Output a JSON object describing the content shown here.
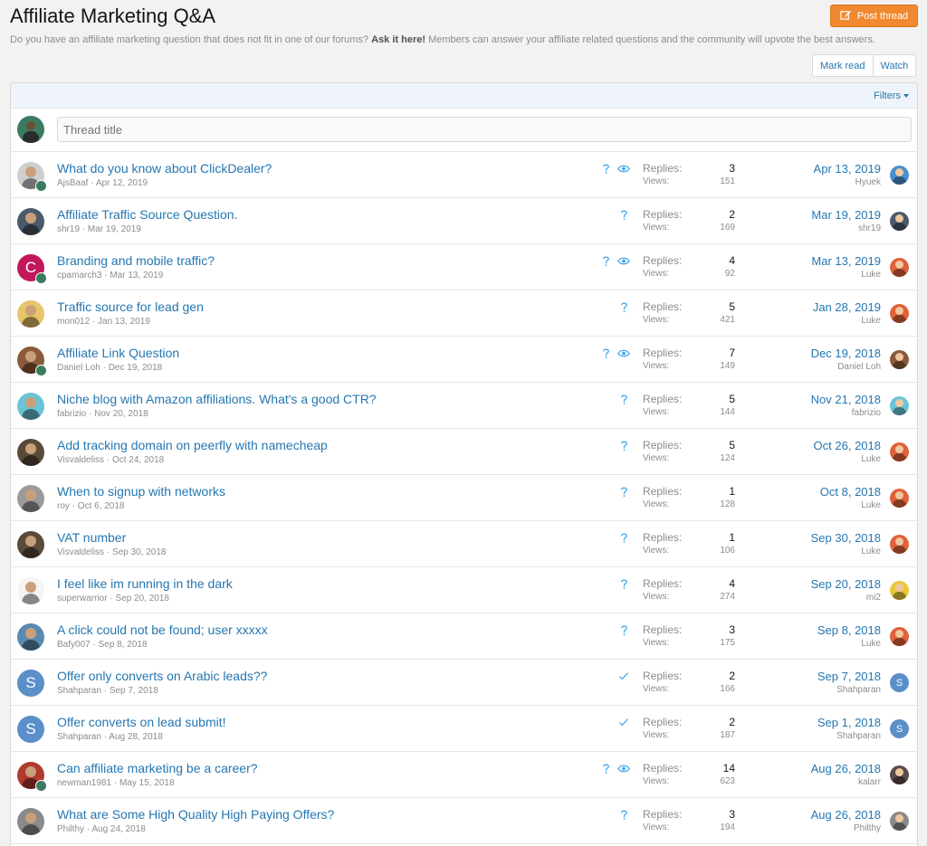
{
  "header": {
    "title": "Affiliate Marketing Q&A",
    "post_button": "Post thread",
    "description_pre": "Do you have an affiliate marketing question that does not fit in one of our forums? ",
    "description_bold": "Ask it here!",
    "description_post": " Members can answer your affiliate related questions and the community will upvote the best answers."
  },
  "actions": {
    "mark_read": "Mark read",
    "watch": "Watch"
  },
  "filters_label": "Filters",
  "quick_thread": {
    "placeholder": "Thread title"
  },
  "labels": {
    "replies": "Replies:",
    "views": "Views:"
  },
  "colors": {
    "link": "#2577b1",
    "accent": "#f0892f",
    "muted": "#8c8c8c"
  },
  "threads": [
    {
      "title": "What do you know about ClickDealer?",
      "author": "AjsBaaf",
      "date": "Apr 12, 2019",
      "replies": "3",
      "views": "151",
      "last_date": "Apr 13, 2019",
      "last_user": "Hyuek",
      "status": "question",
      "watched": true,
      "avatar_color": "#cfcfcf",
      "avatar_letter": "",
      "mini": true,
      "last_avatar_color": "#4a8fd0",
      "last_avatar_letter": ""
    },
    {
      "title": "Affiliate Traffic Source Question.",
      "author": "shr19",
      "date": "Mar 19, 2019",
      "replies": "2",
      "views": "169",
      "last_date": "Mar 19, 2019",
      "last_user": "shr19",
      "status": "question",
      "watched": false,
      "avatar_color": "#4a5a6a",
      "avatar_letter": "",
      "mini": false,
      "last_avatar_color": "#4a5a6a",
      "last_avatar_letter": ""
    },
    {
      "title": "Branding and mobile traffic?",
      "author": "cpamarch3",
      "date": "Mar 13, 2019",
      "replies": "4",
      "views": "92",
      "last_date": "Mar 13, 2019",
      "last_user": "Luke",
      "status": "question",
      "watched": true,
      "avatar_color": "#c2185b",
      "avatar_letter": "C",
      "mini": true,
      "last_avatar_color": "#e0613a",
      "last_avatar_letter": ""
    },
    {
      "title": "Traffic source for lead gen",
      "author": "mon012",
      "date": "Jan 13, 2019",
      "replies": "5",
      "views": "421",
      "last_date": "Jan 28, 2019",
      "last_user": "Luke",
      "status": "question",
      "watched": false,
      "avatar_color": "#e8c46a",
      "avatar_letter": "",
      "mini": false,
      "last_avatar_color": "#e0613a",
      "last_avatar_letter": ""
    },
    {
      "title": "Affiliate Link Question",
      "author": "Daniel Loh",
      "date": "Dec 19, 2018",
      "replies": "7",
      "views": "149",
      "last_date": "Dec 19, 2018",
      "last_user": "Daniel Loh",
      "status": "question",
      "watched": true,
      "avatar_color": "#8a5a3a",
      "avatar_letter": "",
      "mini": true,
      "last_avatar_color": "#8a5a3a",
      "last_avatar_letter": ""
    },
    {
      "title": "Niche blog with Amazon affiliations. What's a good CTR?",
      "author": "fabrizio",
      "date": "Nov 20, 2018",
      "replies": "5",
      "views": "144",
      "last_date": "Nov 21, 2018",
      "last_user": "fabrizio",
      "status": "question",
      "watched": false,
      "avatar_color": "#6ac4d6",
      "avatar_letter": "",
      "mini": false,
      "last_avatar_color": "#6ac4d6",
      "last_avatar_letter": ""
    },
    {
      "title": "Add tracking domain on peerfly with namecheap",
      "author": "Visvaldeliss",
      "date": "Oct 24, 2018",
      "replies": "5",
      "views": "124",
      "last_date": "Oct 26, 2018",
      "last_user": "Luke",
      "status": "question",
      "watched": false,
      "avatar_color": "#5a4a3a",
      "avatar_letter": "",
      "mini": false,
      "last_avatar_color": "#e0613a",
      "last_avatar_letter": ""
    },
    {
      "title": "When to signup with networks",
      "author": "roy",
      "date": "Oct 6, 2018",
      "replies": "1",
      "views": "128",
      "last_date": "Oct 8, 2018",
      "last_user": "Luke",
      "status": "question",
      "watched": false,
      "avatar_color": "#9a9a9a",
      "avatar_letter": "",
      "mini": false,
      "last_avatar_color": "#e0613a",
      "last_avatar_letter": ""
    },
    {
      "title": "VAT number",
      "author": "Visvaldeliss",
      "date": "Sep 30, 2018",
      "replies": "1",
      "views": "106",
      "last_date": "Sep 30, 2018",
      "last_user": "Luke",
      "status": "question",
      "watched": false,
      "avatar_color": "#5a4a3a",
      "avatar_letter": "",
      "mini": false,
      "last_avatar_color": "#e0613a",
      "last_avatar_letter": ""
    },
    {
      "title": "I feel like im running in the dark",
      "author": "superwarrior",
      "date": "Sep 20, 2018",
      "replies": "4",
      "views": "274",
      "last_date": "Sep 20, 2018",
      "last_user": "mi2",
      "status": "question",
      "watched": false,
      "avatar_color": "#f4f4f4",
      "avatar_letter": "",
      "mini": false,
      "last_avatar_color": "#e8c83a",
      "last_avatar_letter": ""
    },
    {
      "title": "A click could not be found; user xxxxx",
      "author": "Bafy007",
      "date": "Sep 8, 2018",
      "replies": "3",
      "views": "175",
      "last_date": "Sep 8, 2018",
      "last_user": "Luke",
      "status": "question",
      "watched": false,
      "avatar_color": "#5a8ab0",
      "avatar_letter": "",
      "mini": false,
      "last_avatar_color": "#e0613a",
      "last_avatar_letter": ""
    },
    {
      "title": "Offer only converts on Arabic leads??",
      "author": "Shahparan",
      "date": "Sep 7, 2018",
      "replies": "2",
      "views": "166",
      "last_date": "Sep 7, 2018",
      "last_user": "Shahparan",
      "status": "solved",
      "watched": false,
      "avatar_color": "#5b8fc9",
      "avatar_letter": "S",
      "mini": false,
      "last_avatar_color": "#5b8fc9",
      "last_avatar_letter": "S"
    },
    {
      "title": "Offer converts on lead submit!",
      "author": "Shahparan",
      "date": "Aug 28, 2018",
      "replies": "2",
      "views": "187",
      "last_date": "Sep 1, 2018",
      "last_user": "Shahparan",
      "status": "solved",
      "watched": false,
      "avatar_color": "#5b8fc9",
      "avatar_letter": "S",
      "mini": false,
      "last_avatar_color": "#5b8fc9",
      "last_avatar_letter": "S"
    },
    {
      "title": "Can affiliate marketing be a career?",
      "author": "newman1981",
      "date": "May 15, 2018",
      "replies": "14",
      "views": "623",
      "last_date": "Aug 26, 2018",
      "last_user": "kalarr",
      "status": "question",
      "watched": true,
      "avatar_color": "#b03a2e",
      "avatar_letter": "",
      "mini": true,
      "last_avatar_color": "#5a4a4a",
      "last_avatar_letter": ""
    },
    {
      "title": "What are Some High Quality High Paying Offers?",
      "author": "Philthy",
      "date": "Aug 24, 2018",
      "replies": "3",
      "views": "194",
      "last_date": "Aug 26, 2018",
      "last_user": "Philthy",
      "status": "question",
      "watched": false,
      "avatar_color": "#8a8a8a",
      "avatar_letter": "",
      "mini": false,
      "last_avatar_color": "#8a8a8a",
      "last_avatar_letter": ""
    }
  ]
}
